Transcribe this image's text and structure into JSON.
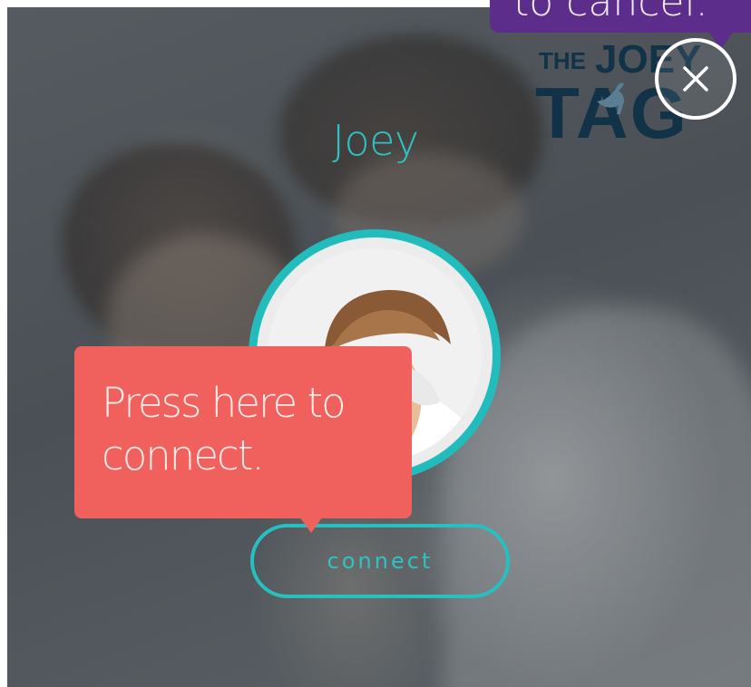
{
  "contact": {
    "name": "Joey"
  },
  "logo": {
    "text_the": "THE",
    "text_joey": "JOEY",
    "text_tag": "TAG"
  },
  "connect_button": {
    "label": "connect"
  },
  "tooltips": {
    "connect_hint_line1": "Press here to",
    "connect_hint_line2": "connect.",
    "cancel_hint": "to cancel."
  },
  "icons": {
    "close": "close-icon",
    "logo_animal": "kangaroo-icon"
  },
  "colors": {
    "accent_teal": "#22bcbc",
    "tooltip_coral": "#f0615d",
    "tooltip_purple": "#5d2d8c",
    "logo_navy": "#123247"
  }
}
